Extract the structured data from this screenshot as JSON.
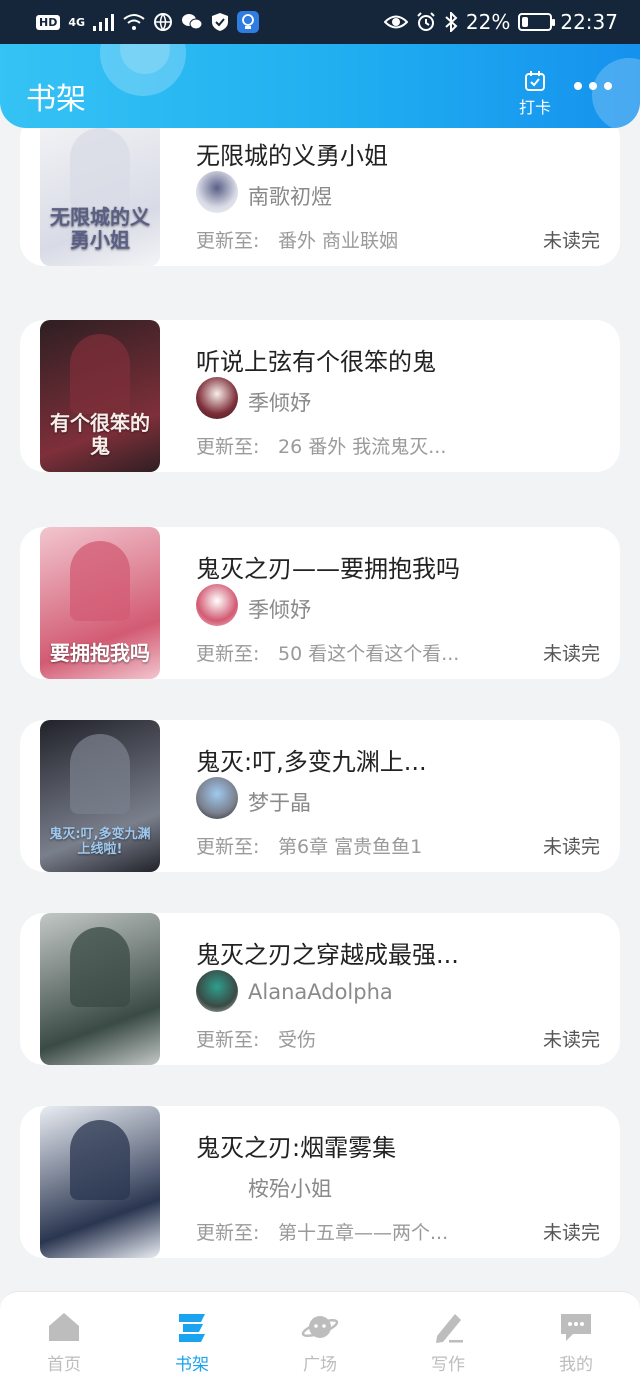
{
  "status_bar": {
    "hd": "HD",
    "network": "4G",
    "battery": "22%",
    "battery_level": 0.22,
    "time": "22:37"
  },
  "header": {
    "title": "书架",
    "checkin_label": "打卡"
  },
  "update_prefix": "更新至:",
  "books": [
    {
      "title": "无限城的义勇小姐",
      "author": "南歌初煜",
      "update": "番外 商业联姻",
      "status": "未读完",
      "cover_text": "无限城的义勇小姐",
      "cover_colors": [
        "#f4f4f6",
        "#d8dbe6",
        "#5b5f86"
      ]
    },
    {
      "title": "听说上弦有个很笨的鬼",
      "author": "季倾妤",
      "update": "26 番外 我流鬼灭...",
      "status": "",
      "cover_text": "有个很笨的鬼",
      "cover_colors": [
        "#2e1f22",
        "#7e2f3a",
        "#f7eeea"
      ]
    },
    {
      "title": "鬼灭之刃——要拥抱我吗",
      "author": "季倾妤",
      "update": "50 看这个看这个看...",
      "status": "未读完",
      "cover_text": "要拥抱我吗",
      "cover_colors": [
        "#f2c6cf",
        "#d25b73",
        "#ffffff"
      ]
    },
    {
      "title": "鬼灭:叮,多变九渊上...",
      "author": "梦于晶",
      "update": "第6章 富贵鱼鱼1",
      "status": "未读完",
      "cover_text": "鬼灭:叮,多变九渊上线啦!",
      "cover_colors": [
        "#21222a",
        "#7a7f8c",
        "#9fc9f0"
      ]
    },
    {
      "title": "鬼灭之刃之穿越成最强...",
      "author": "AlanaAdolpha",
      "update": "受伤",
      "status": "未读完",
      "cover_text": "",
      "cover_colors": [
        "#c3c8c6",
        "#3a4a44",
        "#2f9e8e"
      ]
    },
    {
      "title": "鬼灭之刃:烟霏雾集",
      "author": "桉殆小姐",
      "update": "第十五章——两个...",
      "status": "未读完",
      "cover_text": "",
      "cover_colors": [
        "#e9edf3",
        "#2a3550",
        "#c23b3b"
      ]
    },
    {
      "title": "",
      "author": "",
      "update": "",
      "status": "",
      "cover_text": "",
      "cover_colors": [
        "#b9a9c8",
        "#7a6a8c",
        "#ffffff"
      ]
    }
  ],
  "tabs": [
    {
      "label": "首页",
      "icon": "home-icon",
      "active": false
    },
    {
      "label": "书架",
      "icon": "bookshelf-icon",
      "active": true
    },
    {
      "label": "广场",
      "icon": "planet-icon",
      "active": false
    },
    {
      "label": "写作",
      "icon": "pen-icon",
      "active": false
    },
    {
      "label": "我的",
      "icon": "chat-bubble-icon",
      "active": false
    }
  ],
  "colors": {
    "accent": "#1aa3ee",
    "header_start": "#35c3f5",
    "header_end": "#1591ee",
    "inactive_tab": "#bdbdbd"
  }
}
